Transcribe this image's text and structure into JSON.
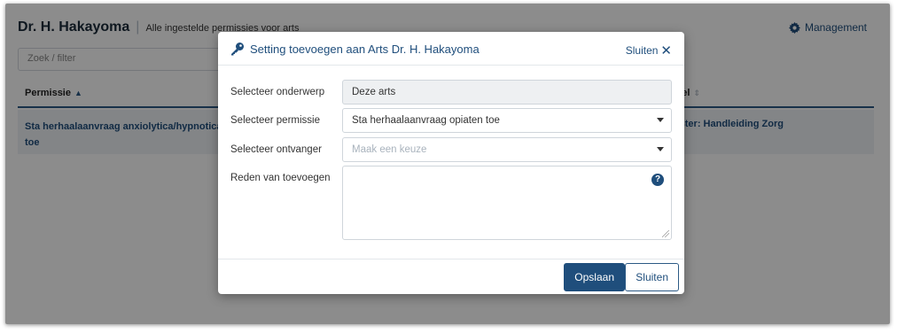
{
  "page": {
    "doctor_name": "Dr. H. Hakayoma",
    "subtitle": "Alle ingestelde permissies voor arts",
    "management_label": "Management",
    "filter_placeholder": "Zoek / filter",
    "table": {
      "col_permissie": "Permissie",
      "col_right_partial": "el",
      "row_permissie": "Sta herhaalaanvraag anxiolytica/hypnotica toe",
      "row_right_partial": "aster: Handleiding Zorg"
    }
  },
  "modal": {
    "title": "Setting toevoegen aan Arts Dr. H. Hakayoma",
    "close_top_label": "Sluiten",
    "fields": {
      "onderwerp_label": "Selecteer onderwerp",
      "onderwerp_value": "Deze arts",
      "permissie_label": "Selecteer permissie",
      "permissie_value": "Sta herhaalaanvraag opiaten toe",
      "ontvanger_label": "Selecteer ontvanger",
      "ontvanger_placeholder": "Maak een keuze",
      "reden_label": "Reden van toevoegen",
      "reden_value": ""
    },
    "save_label": "Opslaan",
    "close_label": "Sluiten"
  },
  "icons": {
    "management": "gear-icon",
    "title": "key-icon",
    "help": "question-circle-icon",
    "close": "close-icon"
  },
  "colors": {
    "primary": "#1f4e7c",
    "row_bg": "#eef2f6"
  }
}
